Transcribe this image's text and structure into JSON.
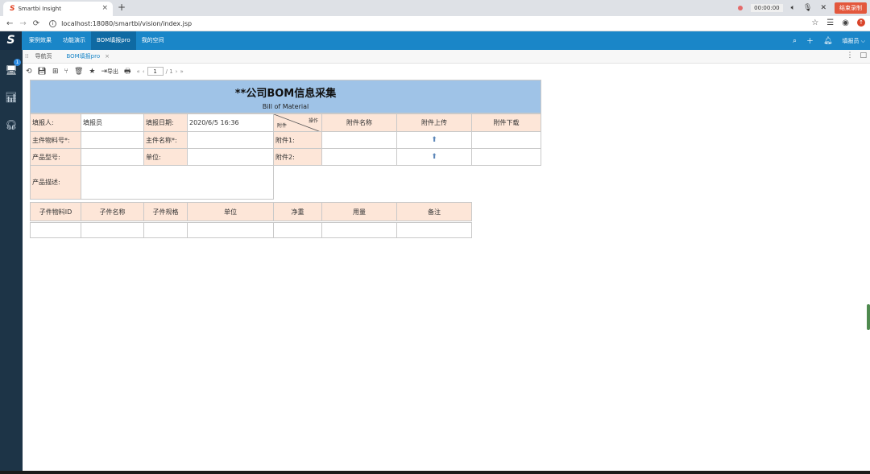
{
  "browser": {
    "tab_title": "Smartbi Insight",
    "tab_close": "×",
    "new_tab": "+",
    "url": "localhost:18080/smartbi/vision/index.jsp",
    "recording": {
      "time": "00:00:00",
      "end_label": "结束录制"
    }
  },
  "app": {
    "logo": "S",
    "menu": [
      {
        "label": "案例效果"
      },
      {
        "label": "功能演示"
      },
      {
        "label": "BOM填报pro"
      },
      {
        "label": "我的空间"
      }
    ],
    "user": "填报员 ⌵",
    "sidebar_badge": "1"
  },
  "page_tabs": {
    "home": "导航页",
    "active": "BOM填报pro",
    "close": "×"
  },
  "toolbar": {
    "export_label": "导出",
    "page_input": "1",
    "page_total": "/ 1"
  },
  "report": {
    "title": "**公司BOM信息采集",
    "subtitle": "Bill of Material",
    "filler_label": "填报人:",
    "filler_value": "填报员",
    "date_label": "填报日期:",
    "date_value": "2020/6/5 16:36",
    "main_id_label": "主件物料号*:",
    "main_name_label": "主件名称*:",
    "model_label": "产品型号:",
    "unit_label": "单位:",
    "desc_label": "产品描述:",
    "attach": {
      "diag_top": "操作",
      "diag_bottom": "附件",
      "name_header": "附件名称",
      "upload_header": "附件上传",
      "download_header": "附件下载",
      "row1": "附件1:",
      "row2": "附件2:"
    },
    "child_headers": [
      "子件物料ID",
      "子件名称",
      "子件规格",
      "单位",
      "净重",
      "用量",
      "备注"
    ]
  }
}
